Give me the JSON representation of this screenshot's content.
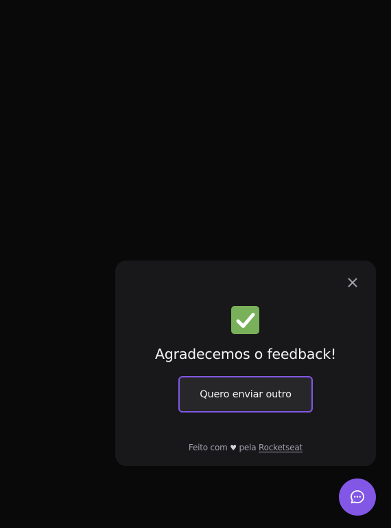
{
  "widget": {
    "title": "Agradecemos o feedback!",
    "again_label": "Quero enviar outro",
    "footer": {
      "prefix": "Feito com",
      "heart": "♥",
      "middle": "pela",
      "link": "Rocketseat"
    }
  },
  "icons": {
    "close": "close-icon",
    "success": "check-mark-button-icon",
    "fab": "chat-bubble-dots-icon"
  },
  "colors": {
    "background": "#09090a",
    "card": "#18181b",
    "button": "#27272a",
    "brand": "#8257e5",
    "success": "#78b159",
    "text": "#f4f4f5",
    "muted": "#a1a1aa"
  }
}
